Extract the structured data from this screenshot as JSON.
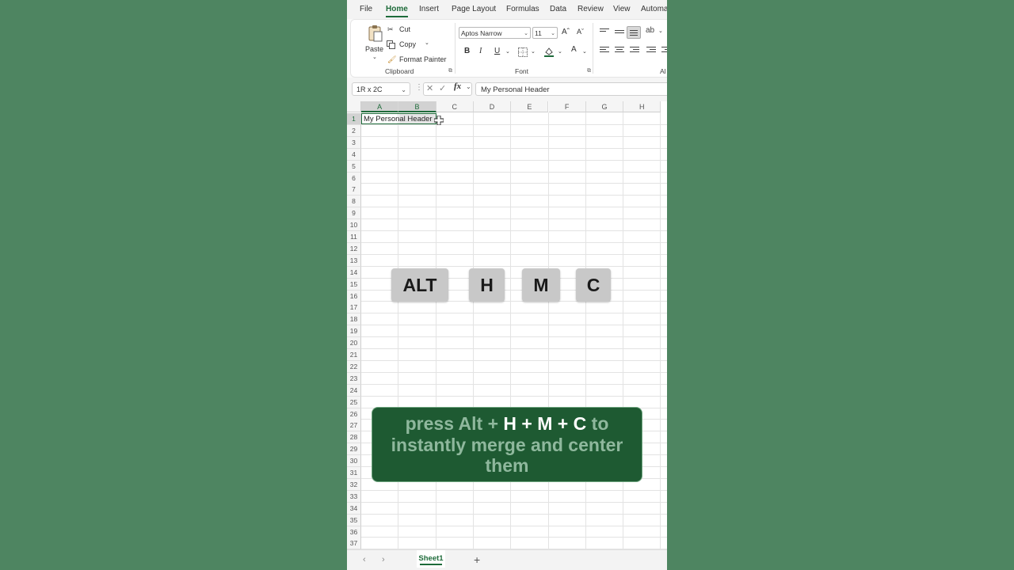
{
  "menu": {
    "items": [
      "File",
      "Home",
      "Insert",
      "Page Layout",
      "Formulas",
      "Data",
      "Review",
      "View",
      "Automa"
    ],
    "active": "Home"
  },
  "ribbon": {
    "clipboard": {
      "paste_label": "Paste",
      "cut_label": "Cut",
      "copy_label": "Copy",
      "format_painter_label": "Format Painter",
      "group_label": "Clipboard"
    },
    "font": {
      "font_name": "Aptos Narrow",
      "font_size": "11",
      "grow_label": "Aˆ",
      "shrink_label": "Aˇ",
      "bold_label": "B",
      "italic_label": "I",
      "underline_label": "U",
      "font_color_label": "A",
      "group_label": "Font"
    },
    "alignment": {
      "group_label": "Al"
    }
  },
  "formula_bar": {
    "name_box": "1R x 2C",
    "fx_label": "fx",
    "content": "My Personal Header"
  },
  "grid": {
    "columns": [
      "A",
      "B",
      "C",
      "D",
      "E",
      "F",
      "G",
      "H"
    ],
    "rows": [
      "1",
      "2",
      "3",
      "4",
      "5",
      "6",
      "7",
      "8",
      "9",
      "10",
      "11",
      "12",
      "13",
      "14",
      "15",
      "16",
      "17",
      "18",
      "19",
      "20",
      "21",
      "22",
      "23",
      "24",
      "25",
      "26",
      "27",
      "28",
      "29",
      "30",
      "31",
      "32",
      "33",
      "34",
      "35",
      "36",
      "37"
    ],
    "selected_columns": [
      "A",
      "B"
    ],
    "selected_row": "1",
    "cell_a1": "My Personal Header"
  },
  "keys": [
    "ALT",
    "H",
    "M",
    "C"
  ],
  "caption": {
    "part1": "press Alt + ",
    "h": "H",
    "plus1": " + ",
    "m": "M",
    "plus2": " + ",
    "c": "C",
    "part2": " to instantly merge and center them"
  },
  "sheet_tabs": {
    "active": "Sheet1",
    "add_label": "+"
  },
  "colors": {
    "accent": "#1e6b3a",
    "background": "#4e8460",
    "caption_bg": "#1e5a32",
    "key_bg": "#c8c8c8"
  }
}
